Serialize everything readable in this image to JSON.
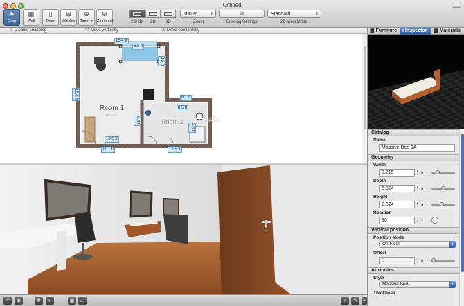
{
  "window": {
    "title": "Untitled"
  },
  "toolbar": {
    "buttons": [
      {
        "label": "Drag",
        "icon": "cursor-icon"
      },
      {
        "label": "Wall",
        "icon": "wall-icon"
      },
      {
        "label": "Door",
        "icon": "door-icon"
      },
      {
        "label": "Window",
        "icon": "window-icon"
      },
      {
        "label": "Zoom in",
        "icon": "zoom-in-icon"
      },
      {
        "label": "Zoom out",
        "icon": "zoom-out-icon"
      }
    ],
    "view_modes": [
      "2D/3D",
      "2D",
      "3D"
    ],
    "zoom": {
      "value": "100 %",
      "label": "Zoom"
    },
    "building_settings": {
      "label": "Building Settings"
    },
    "view_mode_2d": {
      "value": "Standard",
      "label": "2D View Mode"
    }
  },
  "hints": [
    {
      "key": "⇧",
      "text": "Disable snapping"
    },
    {
      "key": "⌥",
      "text": "Move vertically"
    },
    {
      "key": "⌘",
      "text": "Move horizontally"
    }
  ],
  "plan": {
    "room1": {
      "name": "Room 1",
      "area": "188.5 ft²"
    },
    "room2": {
      "name": "Room 2"
    },
    "watermark": "MAGIC",
    "dimensions": [
      "15.4 ft",
      "6.8 ft",
      "3.2 ft",
      "18.8 ft",
      "8.1 ft",
      "8.5 ft",
      "6.4 ft",
      "10.0 ft",
      "11.1 ft",
      "12.5 ft",
      "3.4 ft"
    ]
  },
  "tabs": [
    "Furniture",
    "Inspector",
    "Materials"
  ],
  "inspector": {
    "catalog": {
      "title": "Catalog",
      "name_label": "Name",
      "name_value": "Massive Bed 1A"
    },
    "geometry": {
      "title": "Geometry",
      "width_label": "Width",
      "width_value": "3.215",
      "depth_label": "Depth",
      "depth_value": "6.824",
      "height_label": "Height",
      "height_value": "2.624",
      "rotation_label": "Rotation",
      "rotation_value": "90",
      "unit": "ft",
      "deg": "°"
    },
    "vertical": {
      "title": "Vertical position",
      "mode_label": "Position Mode",
      "mode_value": "On Floor",
      "offset_label": "Offset",
      "offset_value": "0",
      "unit": "ft"
    },
    "attributes": {
      "title": "Attributes",
      "style_label": "Style",
      "style_value": "Massive Bed",
      "thickness_label": "Thickness"
    }
  },
  "colors": {
    "accent": "#3f679a",
    "selected_tab": "#2f5a9a",
    "dimension_tag": "#cfe6f7",
    "wall": "#6b5a4e",
    "floor_wood": "#a0582e"
  }
}
